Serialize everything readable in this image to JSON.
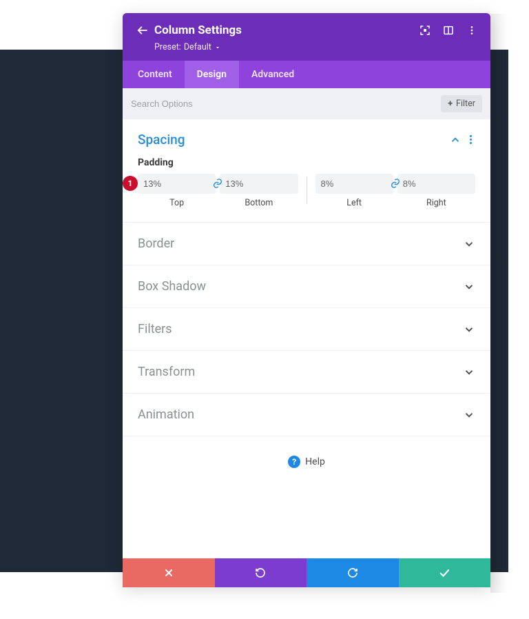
{
  "header": {
    "title": "Column Settings",
    "preset_label": "Preset:",
    "preset_value": "Default"
  },
  "tabs": {
    "items": [
      "Content",
      "Design",
      "Advanced"
    ],
    "active": 1
  },
  "search": {
    "placeholder": "Search Options",
    "filter_label": "Filter"
  },
  "spacing": {
    "title": "Spacing",
    "padding_label": "Padding",
    "badge": "1",
    "fields": {
      "top": {
        "value": "13%",
        "label": "Top"
      },
      "bottom": {
        "value": "13%",
        "label": "Bottom"
      },
      "left": {
        "value": "8%",
        "label": "Left"
      },
      "right": {
        "value": "8%",
        "label": "Right"
      }
    }
  },
  "closed_sections": [
    "Border",
    "Box Shadow",
    "Filters",
    "Transform",
    "Animation"
  ],
  "help_label": "Help",
  "colors": {
    "accent_purple": "#6c2eb9",
    "accent_blue": "#2a8dd6",
    "danger": "#e96a63",
    "success": "#2fb89a"
  }
}
